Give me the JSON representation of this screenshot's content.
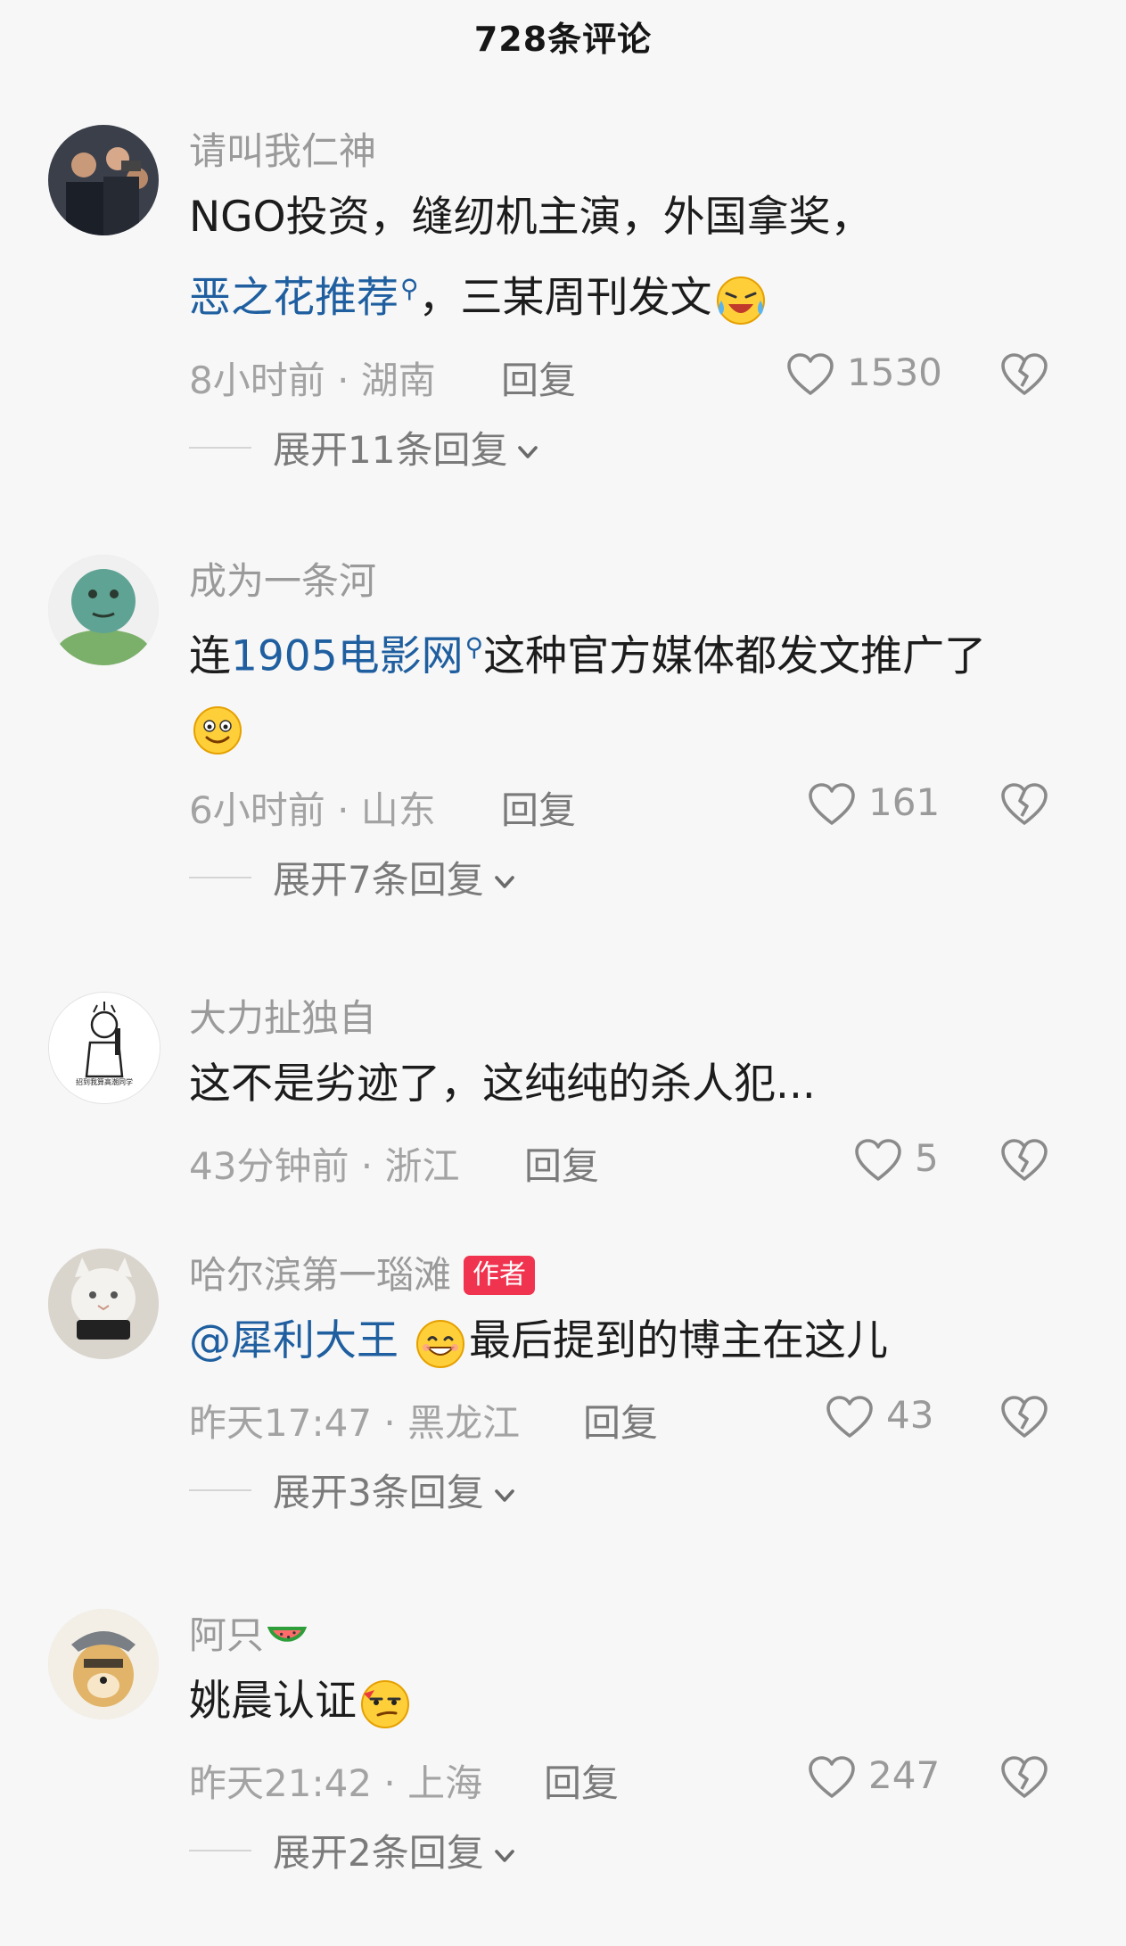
{
  "header": {
    "title": "728条评论"
  },
  "comments": [
    {
      "username": "请叫我仁神",
      "text_part1": "NGO投资，缝纫机主演，外国拿奖，",
      "link": "恶之花推荐",
      "text_part2": "，三某周刊发文",
      "time": "8小时前 · 湖南",
      "reply": "回复",
      "likes": "1530",
      "expand": "展开11条回复"
    },
    {
      "username": "成为一条河",
      "text_prefix": "连",
      "link": "1905电影网",
      "text_part2": "这种官方媒体都发文推广了",
      "time": "6小时前 · 山东",
      "reply": "回复",
      "likes": "161",
      "expand": "展开7条回复"
    },
    {
      "username": "大力扯独自",
      "avatar_caption": "招到我算高潮同学",
      "text": "这不是劣迹了，这纯纯的杀人犯...",
      "time": "43分钟前 · 浙江",
      "reply": "回复",
      "likes": "5"
    },
    {
      "username": "哈尔滨第一瑙滩",
      "badge": "作者",
      "mention": "@犀利大王",
      "text_part2": "最后提到的博主在这儿",
      "time": "昨天17:47 · 黑龙江",
      "reply": "回复",
      "likes": "43",
      "expand": "展开3条回复"
    },
    {
      "username": "阿只",
      "text": "姚晨认证",
      "time": "昨天21:42 · 上海",
      "reply": "回复",
      "likes": "247",
      "expand": "展开2条回复"
    }
  ],
  "icons": [
    "heart-outline-icon",
    "broken-heart-icon",
    "chevron-down-icon",
    "search-icon"
  ]
}
